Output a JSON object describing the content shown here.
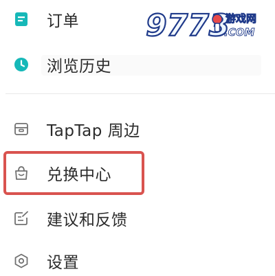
{
  "menu": {
    "items": [
      {
        "label": "订单",
        "icon": "order-icon"
      },
      {
        "label": "浏览历史",
        "icon": "history-clock-icon"
      },
      {
        "label": "TapTap 周边",
        "icon": "merch-box-icon"
      },
      {
        "label": "兑换中心",
        "icon": "redeem-bag-icon"
      },
      {
        "label": "建议和反馈",
        "icon": "feedback-edit-icon"
      },
      {
        "label": "设置",
        "icon": "settings-hex-icon"
      }
    ]
  },
  "watermark": {
    "number": "9773",
    "site_cn": "游戏网",
    "site_en": ".COM"
  },
  "colors": {
    "accent": "#16b8b8",
    "icon_gray": "#707070",
    "highlight": "#d9534f",
    "text": "#2b2b2b"
  }
}
